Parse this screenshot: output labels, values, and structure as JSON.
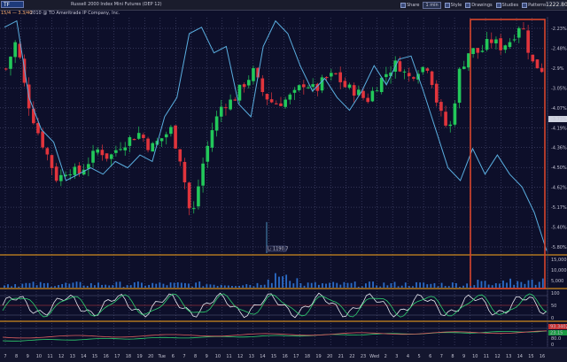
{
  "header": {
    "symbol": "TF",
    "title": "Russell 2000 Index Mini Futures (DEP 12)",
    "last_price": "1222.80",
    "tools": [
      {
        "label": "Share",
        "icon": "share-icon"
      },
      {
        "label": "1 min",
        "icon": "timeframe-dropdown"
      },
      {
        "label": "Style",
        "icon": "style-icon"
      },
      {
        "label": "Drawings",
        "icon": "drawings-icon"
      },
      {
        "label": "Studies",
        "icon": "studies-icon"
      },
      {
        "label": "Patterns",
        "icon": "patterns-icon"
      }
    ]
  },
  "subbar": {
    "study_label": "15/4 — 3.3/40",
    "date_label": "2010 @ TD Ameritrade IP Company, Inc."
  },
  "price_axis": {
    "ticks": [
      "-2.23%",
      "-2.48%",
      "-2.9%",
      "-3.05%",
      "-4.07%",
      "-4.19%",
      "-4.36%",
      "-4.50%",
      "-4.62%",
      "-5.17%",
      "-5.40%",
      "-5.80%"
    ],
    "current_value": "-3.73%",
    "low_label": "L: 1190.7"
  },
  "volume_axis": {
    "ticks": [
      "15,000",
      "10,000",
      "5,000"
    ]
  },
  "oscillator_axis": {
    "ticks": [
      "100",
      "50",
      "0"
    ]
  },
  "bottom_axis": {
    "ticks": [
      "80.0",
      "0"
    ],
    "badge_red": "93.3402",
    "badge_green": "23.15"
  },
  "x_axis": {
    "labels": [
      "7",
      "8",
      "9",
      "10",
      "11",
      "12",
      "13",
      "14",
      "15",
      "16",
      "17",
      "18",
      "19",
      "20",
      "Tue",
      "6",
      "7",
      "8",
      "9",
      "10",
      "11",
      "12",
      "13",
      "14",
      "15",
      "16",
      "17",
      "18",
      "19",
      "20",
      "21",
      "22",
      "23",
      "Wed",
      "2",
      "3",
      "4",
      "5",
      "6",
      "7",
      "8",
      "9",
      "10",
      "11",
      "12",
      "13",
      "14",
      "15",
      "16"
    ]
  },
  "colors": {
    "background": "#0d0f2a",
    "grid": "#5a5c85",
    "candle_up": "#22c85a",
    "candle_down": "#e0343c",
    "overlay_line": "#5aaee0",
    "separator": "#d08a1e",
    "highlight_box": "#d8452c"
  },
  "chart_data": {
    "type": "candlestick",
    "series": [
      {
        "name": "price",
        "values": [
          -2.95,
          -2.5,
          -3.4,
          -3.9,
          -4.3,
          -4.7,
          -4.5,
          -4.6,
          -4.4,
          -4.2,
          -4.35,
          -4.15,
          -4.05,
          -3.95,
          -4.2,
          -4.05,
          -3.9,
          -4.4,
          -5.35,
          -4.5,
          -3.9,
          -3.5,
          -3.45,
          -3.2,
          -3.0,
          -3.35,
          -3.5,
          -3.45,
          -3.35,
          -3.15,
          -3.3,
          -3.1,
          -3.05,
          -3.25,
          -3.3,
          -3.45,
          -3.2,
          -3.0,
          -2.85,
          -3.1,
          -2.95,
          -2.9,
          -3.6,
          -3.95,
          -3.0,
          -2.65,
          -2.7,
          -2.5,
          -2.6,
          -2.5,
          -2.2,
          -2.85,
          -2.95
        ]
      },
      {
        "name": "overlay",
        "values": [
          -2.3,
          -2.2,
          -3.4,
          -3.9,
          -4.1,
          -4.7,
          -4.6,
          -4.5,
          -4.6,
          -4.4,
          -4.5,
          -4.3,
          -4.4,
          -3.7,
          -3.4,
          -2.4,
          -2.3,
          -2.7,
          -2.6,
          -3.5,
          -3.7,
          -2.6,
          -2.2,
          -2.4,
          -2.9,
          -3.3,
          -3.1,
          -3.4,
          -3.6,
          -3.3,
          -2.9,
          -3.2,
          -2.8,
          -2.75,
          -3.3,
          -3.9,
          -4.5,
          -4.7,
          -4.2,
          -4.6,
          -4.3,
          -4.6,
          -4.8,
          -5.2,
          -5.8
        ]
      }
    ],
    "low_value": 1190.7,
    "ylim": [
      -5.85,
      -2.15
    ]
  }
}
